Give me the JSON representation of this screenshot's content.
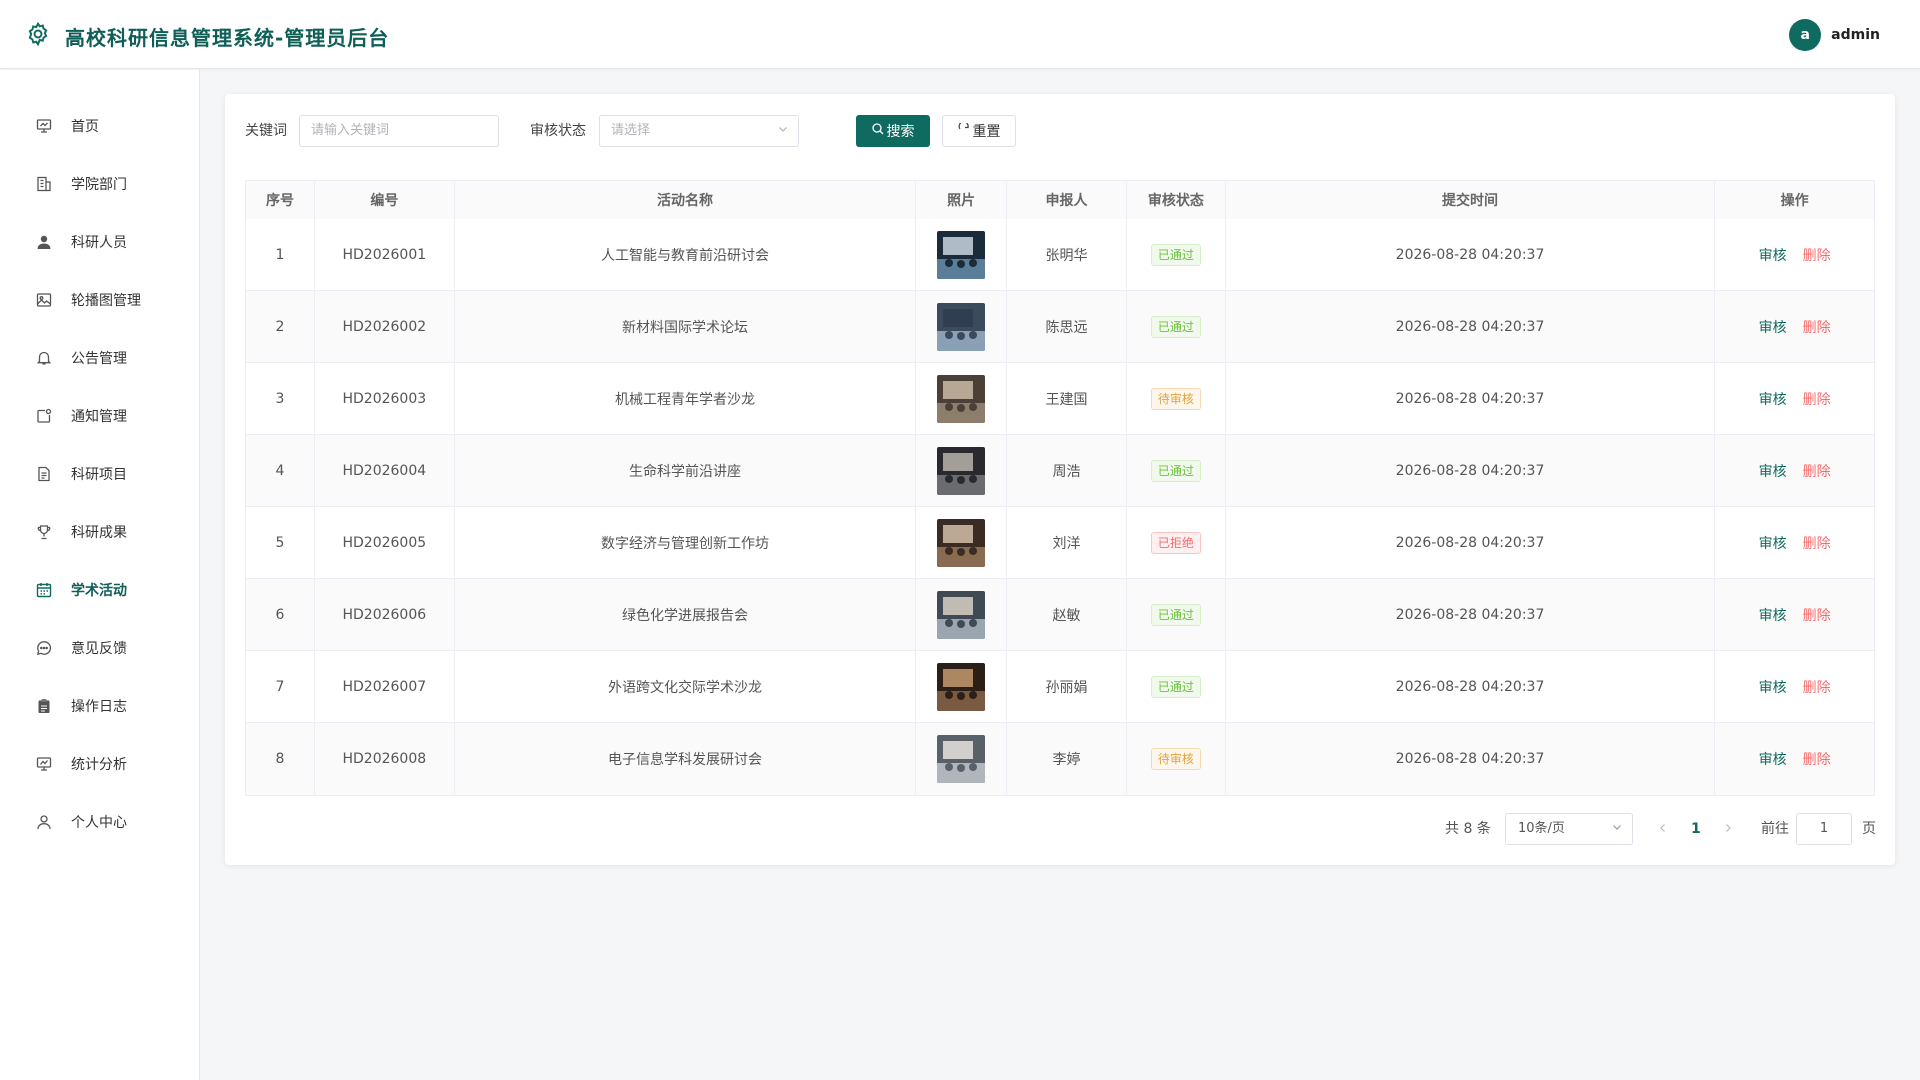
{
  "header": {
    "title": "高校科研信息管理系统-管理员后台",
    "avatar_letter": "a",
    "username": "admin"
  },
  "sidebar": {
    "active_index": 8,
    "items": [
      {
        "label": "首页",
        "icon": "home-icon"
      },
      {
        "label": "学院部门",
        "icon": "building-icon"
      },
      {
        "label": "科研人员",
        "icon": "user-icon"
      },
      {
        "label": "轮播图管理",
        "icon": "image-icon"
      },
      {
        "label": "公告管理",
        "icon": "bell-icon"
      },
      {
        "label": "通知管理",
        "icon": "notification-icon"
      },
      {
        "label": "科研项目",
        "icon": "document-icon"
      },
      {
        "label": "科研成果",
        "icon": "trophy-icon"
      },
      {
        "label": "学术活动",
        "icon": "calendar-icon"
      },
      {
        "label": "意见反馈",
        "icon": "chat-icon"
      },
      {
        "label": "操作日志",
        "icon": "clipboard-icon"
      },
      {
        "label": "统计分析",
        "icon": "chart-icon"
      },
      {
        "label": "个人中心",
        "icon": "profile-icon"
      }
    ]
  },
  "search": {
    "keyword_label": "关键词",
    "keyword_placeholder": "请输入关键词",
    "status_label": "审核状态",
    "status_placeholder": "请选择",
    "search_button": "搜索",
    "reset_button": "重置"
  },
  "table": {
    "headers": [
      "序号",
      "编号",
      "活动名称",
      "照片",
      "申报人",
      "审核状态",
      "提交时间",
      "操作"
    ],
    "audit_label": "审核",
    "delete_label": "删除",
    "rows": [
      {
        "index": "1",
        "code": "HD2026001",
        "name": "人工智能与教育前沿研讨会",
        "applicant": "张明华",
        "status": "已通过",
        "time": "2026-08-28 04:20:37"
      },
      {
        "index": "2",
        "code": "HD2026002",
        "name": "新材料国际学术论坛",
        "applicant": "陈思远",
        "status": "已通过",
        "time": "2026-08-28 04:20:37"
      },
      {
        "index": "3",
        "code": "HD2026003",
        "name": "机械工程青年学者沙龙",
        "applicant": "王建国",
        "status": "待审核",
        "time": "2026-08-28 04:20:37"
      },
      {
        "index": "4",
        "code": "HD2026004",
        "name": "生命科学前沿讲座",
        "applicant": "周浩",
        "status": "已通过",
        "time": "2026-08-28 04:20:37"
      },
      {
        "index": "5",
        "code": "HD2026005",
        "name": "数字经济与管理创新工作坊",
        "applicant": "刘洋",
        "status": "已拒绝",
        "time": "2026-08-28 04:20:37"
      },
      {
        "index": "6",
        "code": "HD2026006",
        "name": "绿色化学进展报告会",
        "applicant": "赵敏",
        "status": "已通过",
        "time": "2026-08-28 04:20:37"
      },
      {
        "index": "7",
        "code": "HD2026007",
        "name": "外语跨文化交际学术沙龙",
        "applicant": "孙丽娟",
        "status": "已通过",
        "time": "2026-08-28 04:20:37"
      },
      {
        "index": "8",
        "code": "HD2026008",
        "name": "电子信息学科发展研讨会",
        "applicant": "李婷",
        "status": "待审核",
        "time": "2026-08-28 04:20:37"
      }
    ]
  },
  "pagination": {
    "total_text": "共 8 条",
    "page_size": "10条/页",
    "current_page": "1",
    "goto_label": "前往",
    "goto_value": "1",
    "page_suffix": "页"
  },
  "colors": {
    "primary": "#0f6b5f",
    "success": "#67c23a",
    "warning": "#e6a23c",
    "danger": "#f56c6c"
  }
}
